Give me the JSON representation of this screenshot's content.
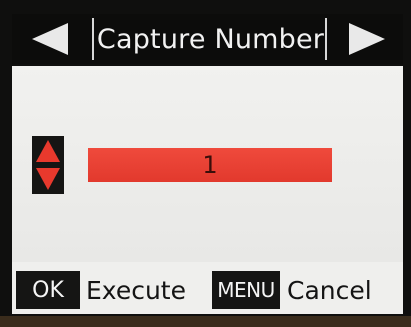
{
  "header": {
    "title": "Capture Number",
    "prev_icon": "left-arrow-icon",
    "next_icon": "right-arrow-icon"
  },
  "setting": {
    "stepper_icon": "up-down-arrows-icon",
    "value": "1"
  },
  "footer": {
    "ok_key": "OK",
    "ok_action": "Execute",
    "menu_key": "MENU",
    "menu_action": "Cancel"
  },
  "colors": {
    "header_background": "#0c0c0b",
    "header_text": "#f2f2f2",
    "content_background": "#ececea",
    "value_bar": "#ea4436",
    "stepper_arrows": "#e8392d",
    "key_background": "#151514"
  }
}
